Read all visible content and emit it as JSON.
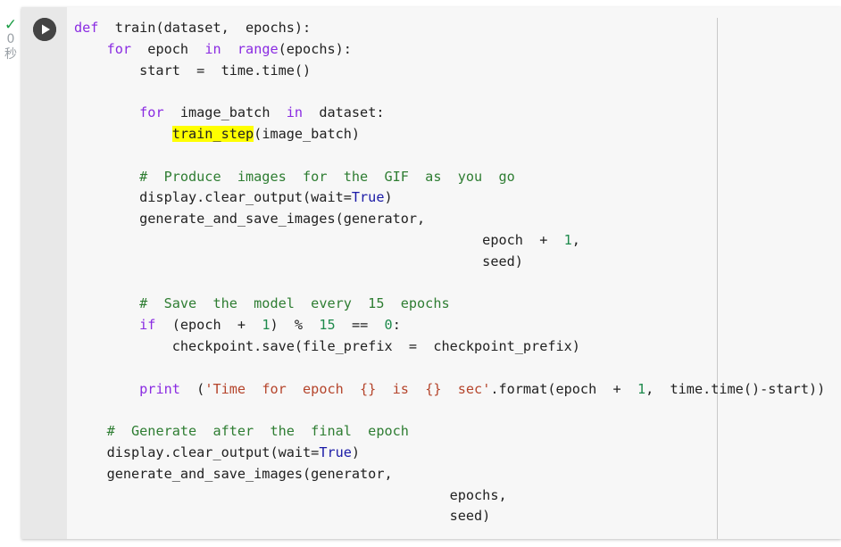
{
  "cell_status": {
    "check_glyph": "✓",
    "duration_value": "0",
    "duration_unit": "秒"
  },
  "run_button": {
    "icon": "play-icon",
    "color": "#444444"
  },
  "highlight_color": "#ffff00",
  "code_lines": [
    "def  train(dataset,  epochs):",
    "    for  epoch  in  range(epochs):",
    "        start  =  time.time()",
    "",
    "        for  image_batch  in  dataset:",
    "            train_step(image_batch)",
    "",
    "        #  Produce  images  for  the  GIF  as  you  go",
    "        display.clear_output(wait=True)",
    "        generate_and_save_images(generator,",
    "                                                  epoch  +  1,",
    "                                                  seed)",
    "",
    "        #  Save  the  model  every  15  epochs",
    "        if  (epoch  +  1)  %  15  ==  0:",
    "            checkpoint.save(file_prefix  =  checkpoint_prefix)",
    "",
    "        print  ('Time  for  epoch  {}  is  {}  sec'.format(epoch  +  1,  time.time()-start))",
    "",
    "    #  Generate  after  the  final  epoch",
    "    display.clear_output(wait=True)",
    "    generate_and_save_images(generator,",
    "                                              epochs,",
    "                                              seed)"
  ]
}
